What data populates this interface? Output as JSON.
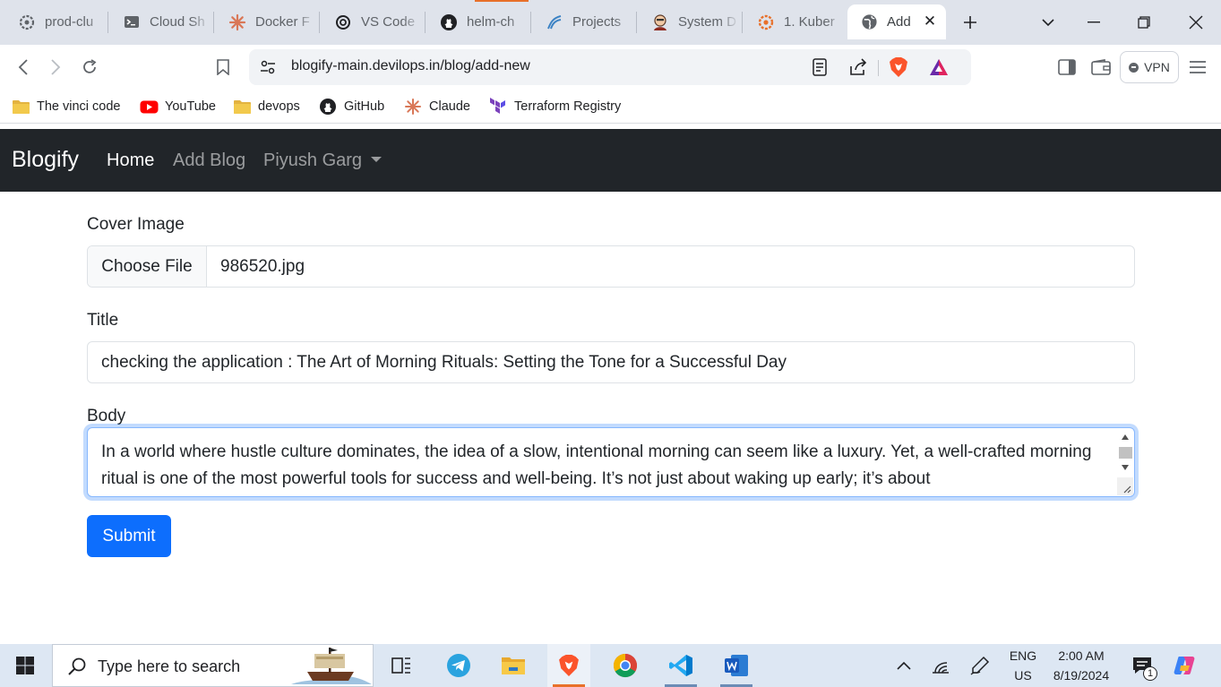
{
  "browser": {
    "tabs": [
      {
        "label": "prod-clu",
        "icon": "gear-icon"
      },
      {
        "label": "Cloud Sh",
        "icon": "terminal-icon"
      },
      {
        "label": "Docker F",
        "icon": "claude-icon"
      },
      {
        "label": "VS Code",
        "icon": "openai-icon"
      },
      {
        "label": "helm-ch",
        "icon": "github-icon"
      },
      {
        "label": "Projects",
        "icon": "projects-icon"
      },
      {
        "label": "System D",
        "icon": "avatar-icon"
      },
      {
        "label": "1. Kuber",
        "icon": "gitlab-icon"
      },
      {
        "label": "Add",
        "icon": "globe-icon",
        "active": true
      }
    ],
    "url_host": "blogify-main.devilops.in",
    "url_path": "/blog/add-new",
    "vpn_label": "VPN",
    "bookmarks": [
      {
        "label": "The vinci code",
        "icon": "folder-icon"
      },
      {
        "label": "YouTube",
        "icon": "youtube-icon"
      },
      {
        "label": "devops",
        "icon": "folder-icon"
      },
      {
        "label": "GitHub",
        "icon": "github-icon"
      },
      {
        "label": "Claude",
        "icon": "claude-icon"
      },
      {
        "label": "Terraform Registry",
        "icon": "terraform-icon"
      }
    ]
  },
  "app": {
    "brand": "Blogify",
    "nav": {
      "home": "Home",
      "add_blog": "Add Blog",
      "user": "Piyush Garg"
    }
  },
  "form": {
    "cover_label": "Cover Image",
    "choose_file": "Choose File",
    "file_name": "986520.jpg",
    "title_label": "Title",
    "title_value": "checking the application : The Art of Morning Rituals: Setting the Tone for a Successful Day",
    "body_label": "Body",
    "body_value": "In a world where hustle culture dominates, the idea of a slow, intentional morning can seem like a luxury. Yet, a well-crafted morning ritual is one of the most powerful tools for success and well-being. It’s not just about waking up early; it’s about",
    "submit": "Submit"
  },
  "taskbar": {
    "search_placeholder": "Type here to search",
    "lang": "ENG",
    "region": "US",
    "time": "2:00 AM",
    "date": "8/19/2024",
    "notification_count": "1"
  },
  "colors": {
    "primary": "#0d6efd",
    "navbar": "#212529",
    "tabstrip": "#dfe3eb",
    "taskbar": "#dde7f3"
  }
}
